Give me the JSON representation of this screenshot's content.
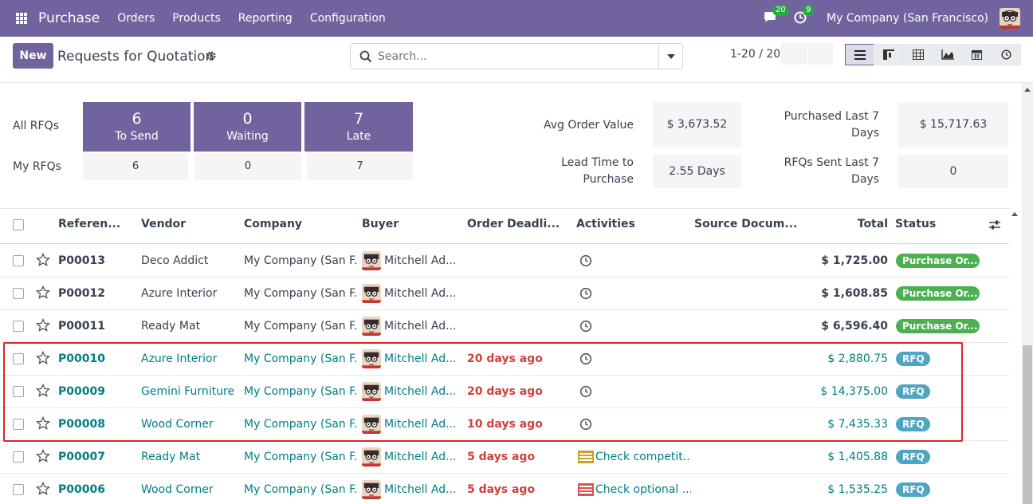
{
  "navbar": {
    "app_name": "Purchase",
    "menu": [
      "Orders",
      "Products",
      "Reporting",
      "Configuration"
    ],
    "messages_count": "20",
    "activities_count": "9",
    "company": "My Company (San Francisco)"
  },
  "control": {
    "new_label": "New",
    "title": "Requests for Quotation",
    "search_placeholder": "Search...",
    "pager": "1-20 / 20"
  },
  "dashboard": {
    "all_rfqs_label": "All RFQs",
    "my_rfqs_label": "My RFQs",
    "tiles": [
      {
        "value": "6",
        "label": "To Send",
        "mine": "6"
      },
      {
        "value": "0",
        "label": "Waiting",
        "mine": "0"
      },
      {
        "value": "7",
        "label": "Late",
        "mine": "7"
      }
    ],
    "avg_order_label": "Avg Order Value",
    "avg_order_value": "$ 3,673.52",
    "lead_time_label_1": "Lead Time to",
    "lead_time_label_2": "Purchase",
    "lead_time_value": "2.55 Days",
    "purchased_label_1": "Purchased Last 7",
    "purchased_label_2": "Days",
    "purchased_value": "$ 15,717.63",
    "rfqs_sent_label_1": "RFQs Sent Last 7",
    "rfqs_sent_label_2": "Days",
    "rfqs_sent_value": "0"
  },
  "table": {
    "headers": {
      "reference": "Referen...",
      "vendor": "Vendor",
      "company": "Company",
      "buyer": "Buyer",
      "deadline": "Order Deadli...",
      "activities": "Activities",
      "source": "Source Docum...",
      "total": "Total",
      "status": "Status"
    },
    "rows": [
      {
        "ref": "P00013",
        "vendor": "Deco Addict",
        "company": "My Company (San F...",
        "buyer": "Mitchell Ad...",
        "deadline": "",
        "activity": "",
        "total": "$ 1,725.00",
        "status": "Purchase Or..."
      },
      {
        "ref": "P00012",
        "vendor": "Azure Interior",
        "company": "My Company (San F...",
        "buyer": "Mitchell Ad...",
        "deadline": "",
        "activity": "",
        "total": "$ 1,608.85",
        "status": "Purchase Or..."
      },
      {
        "ref": "P00011",
        "vendor": "Ready Mat",
        "company": "My Company (San F...",
        "buyer": "Mitchell Ad...",
        "deadline": "",
        "activity": "",
        "total": "$ 6,596.40",
        "status": "Purchase Or..."
      },
      {
        "ref": "P00010",
        "vendor": "Azure Interior",
        "company": "My Company (San F...",
        "buyer": "Mitchell Ad...",
        "deadline": "20 days ago",
        "activity": "",
        "total": "$ 2,880.75",
        "status": "RFQ"
      },
      {
        "ref": "P00009",
        "vendor": "Gemini Furniture",
        "company": "My Company (San F...",
        "buyer": "Mitchell Ad...",
        "deadline": "20 days ago",
        "activity": "",
        "total": "$ 14,375.00",
        "status": "RFQ"
      },
      {
        "ref": "P00008",
        "vendor": "Wood Corner",
        "company": "My Company (San F...",
        "buyer": "Mitchell Ad...",
        "deadline": "10 days ago",
        "activity": "",
        "total": "$ 7,435.33",
        "status": "RFQ"
      },
      {
        "ref": "P00007",
        "vendor": "Ready Mat",
        "company": "My Company (San F...",
        "buyer": "Mitchell Ad...",
        "deadline": "5 days ago",
        "activity": "Check competit...",
        "total": "$ 1,405.88",
        "status": "RFQ"
      },
      {
        "ref": "P00006",
        "vendor": "Wood Corner",
        "company": "My Company (San F...",
        "buyer": "Mitchell Ad...",
        "deadline": "5 days ago",
        "activity": "Check optional ...",
        "total": "$ 1,535.25",
        "status": "RFQ"
      }
    ]
  },
  "colors": {
    "brand": "#71639e",
    "deadline": "#d23f3a",
    "link": "#017e84",
    "status_done": "#4caf50",
    "status_rfq": "#4fa6c2",
    "highlight": "#e02424"
  }
}
